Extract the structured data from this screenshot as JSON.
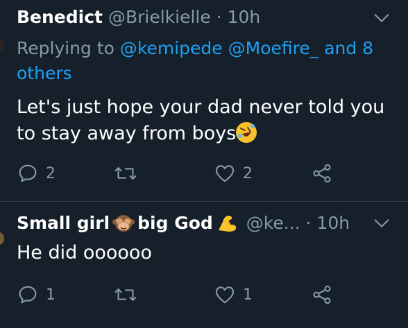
{
  "tweets": [
    {
      "name": "Benedict",
      "handle": "@Brielkielle",
      "dot": "·",
      "time": "10h",
      "reply_prefix": "Replying to",
      "reply_mentions": [
        "@kemipede",
        "@Moefire_"
      ],
      "reply_rest": "and 8 others",
      "text": "Let's just hope your dad never told you to stay away from boys",
      "text_emoji": "rolling-on-floor-laughing-emoji",
      "replies": "2",
      "retweets": "",
      "likes": "2"
    },
    {
      "name_part1": "Small girl",
      "name_emoji1": "see-no-evil-monkey-emoji",
      "name_part2": "big God",
      "name_emoji2": "flexed-biceps-emoji",
      "handle": "@ke...",
      "dot": "·",
      "time": "10h",
      "text": "He did oooooo",
      "replies": "1",
      "retweets": "",
      "likes": "1"
    }
  ],
  "colors": {
    "background": "#15202b",
    "secondary_text": "#8899a6",
    "link": "#1da1f2",
    "divider": "#2f3d4c"
  },
  "icons": [
    "chevron-down-icon",
    "reply-icon",
    "retweet-icon",
    "like-icon",
    "share-icon"
  ]
}
